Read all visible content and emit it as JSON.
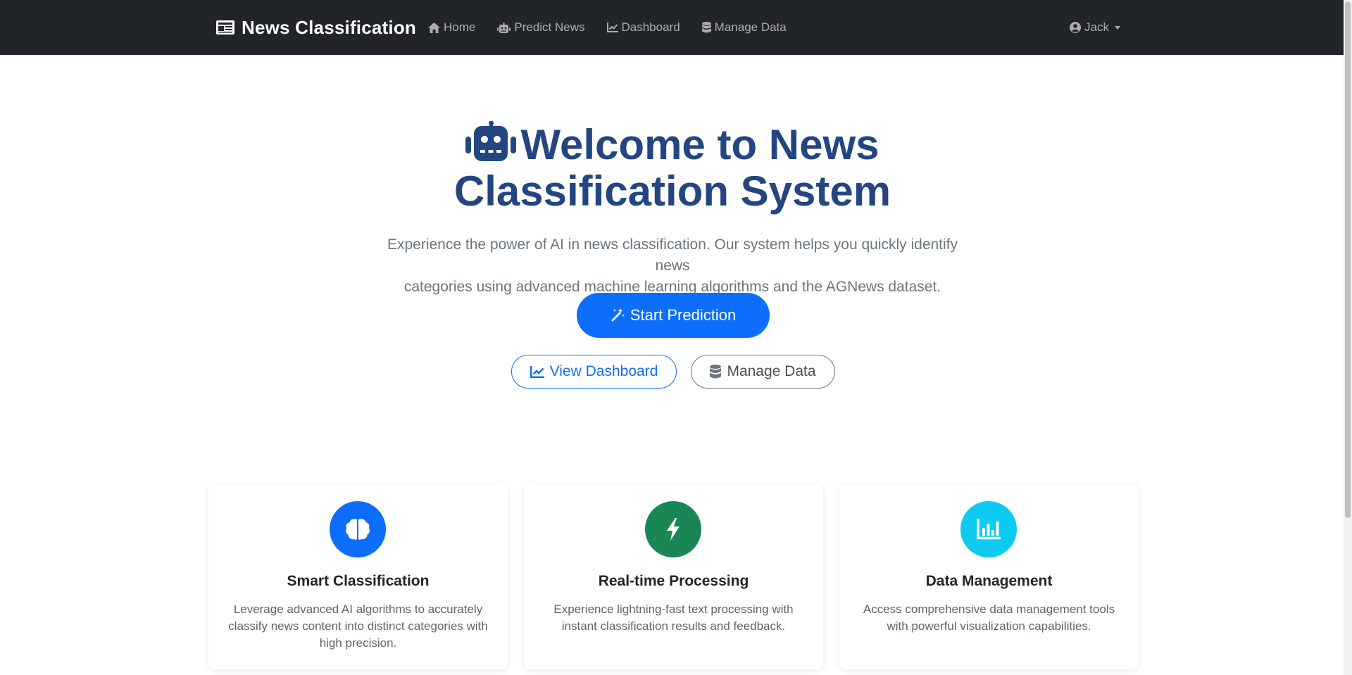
{
  "navbar": {
    "brand": "News Classification",
    "links": [
      {
        "label": "Home",
        "icon": "home-icon"
      },
      {
        "label": "Predict News",
        "icon": "robot-icon"
      },
      {
        "label": "Dashboard",
        "icon": "chart-line-icon"
      },
      {
        "label": "Manage Data",
        "icon": "database-icon"
      }
    ],
    "user": {
      "name": "Jack",
      "icon": "user-circle-icon"
    }
  },
  "hero": {
    "title_line1": "Welcome to News",
    "title_line2": "Classification System",
    "lead_line1": "Experience the power of AI in news classification. Our system helps you quickly identify news",
    "lead_line2": "categories using advanced machine learning algorithms and the AGNews dataset.",
    "primary_button": "Start Prediction",
    "dashboard_button": "View Dashboard",
    "manage_button": "Manage Data"
  },
  "features": [
    {
      "title": "Smart Classification",
      "text": "Leverage advanced AI algorithms to accurately classify news content into distinct categories with high precision.",
      "icon": "brain-icon",
      "color": "#0d6efd"
    },
    {
      "title": "Real-time Processing",
      "text": "Experience lightning-fast text processing with instant classification results and feedback.",
      "icon": "bolt-icon",
      "color": "#198754"
    },
    {
      "title": "Data Management",
      "text": "Access comprehensive data management tools with powerful visualization capabilities.",
      "icon": "chart-bar-icon",
      "color": "#0dcaf0"
    }
  ],
  "colors": {
    "navbar": "#212529",
    "title": "#234682",
    "primary": "#0d6efd"
  }
}
